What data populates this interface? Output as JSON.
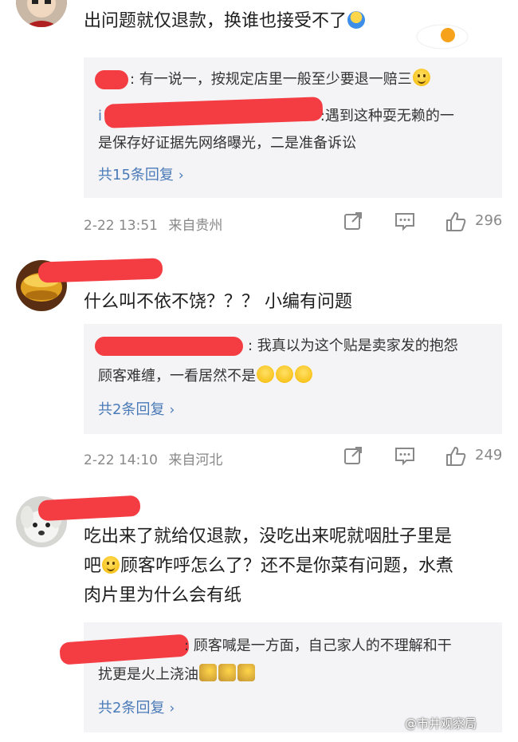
{
  "comments": [
    {
      "body_parts": [
        "出问题就仅退款，换谁也接受不了"
      ],
      "replies": [
        ": 有一说一，按规定店里一般至少要退一赔三",
        ":遇到这种耍无赖的一",
        "是保存好证据先网络曝光，二是准备诉讼"
      ],
      "reply_prefix_fragment": "i",
      "more_label": "共15条回复",
      "time": "2-22 13:51",
      "location": "来自贵州",
      "likes": "296"
    },
    {
      "body_parts": [
        "什么叫不依不饶？？？ 小编有问题"
      ],
      "replies": [
        ": 我真以为这个贴是卖家发的抱怨",
        "顾客难缠，一看居然不是"
      ],
      "more_label": "共2条回复",
      "time": "2-22 14:10",
      "location": "来自河北",
      "likes": "249"
    },
    {
      "body_lines": [
        "吃出来了就给仅退款，没吃出来呢就咽肚子里是",
        "顾客咋呼怎么了？还不是你菜有问题，水煮",
        "肉片里为什么会有纸"
      ],
      "body_line2_prefix": "吧",
      "replies": [
        ": 顾客喊是一方面，自己家人的不理解和干",
        "扰更是火上浇油"
      ],
      "more_label": "共2条回复"
    }
  ],
  "watermark": "@市井观察局",
  "icons": {
    "share": "share-icon",
    "comment": "comment-icon",
    "like": "thumbs-up-icon"
  },
  "colors": {
    "reply_link": "#4a7ab8",
    "meta": "#888888",
    "redaction": "#f43c43",
    "reply_bg": "#f4f4f6"
  }
}
